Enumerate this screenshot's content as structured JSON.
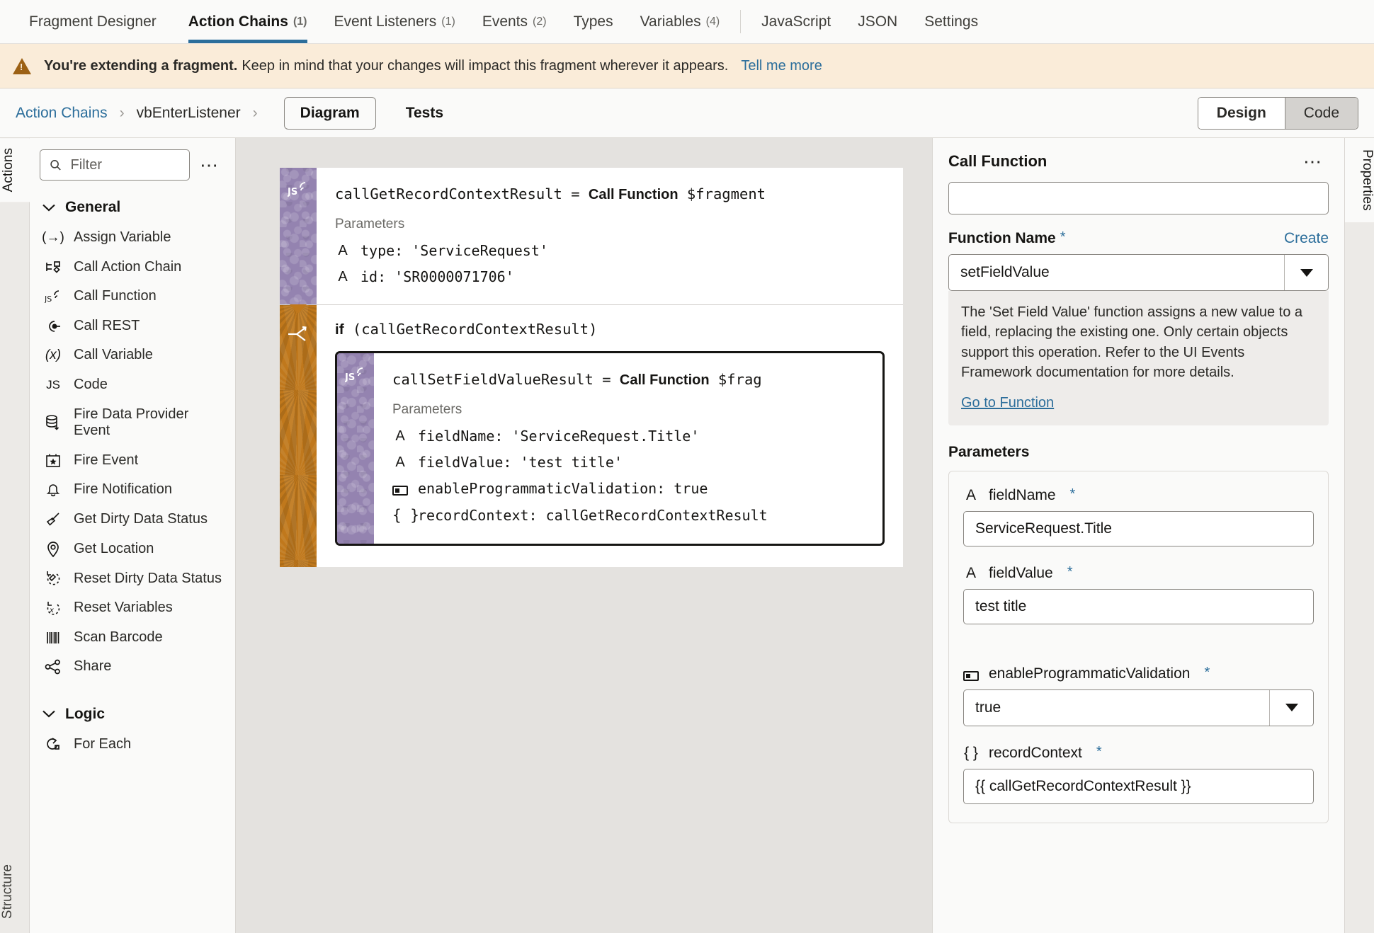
{
  "theme": {
    "accent": "#2c6e9b",
    "warning_bg": "#faecd9",
    "js_node": "#9483b0",
    "if_node": "#c0781c"
  },
  "topbar": {
    "tabs": [
      {
        "label": "Fragment Designer",
        "count": "",
        "active": false
      },
      {
        "label": "Action Chains",
        "count": "(1)",
        "active": true
      },
      {
        "label": "Event Listeners",
        "count": "(1)",
        "active": false
      },
      {
        "label": "Events",
        "count": "(2)",
        "active": false
      },
      {
        "label": "Types",
        "count": "",
        "active": false
      },
      {
        "label": "Variables",
        "count": "(4)",
        "active": false
      }
    ],
    "tabs_right": [
      {
        "label": "JavaScript",
        "count": "",
        "active": false
      },
      {
        "label": "JSON",
        "count": "",
        "active": false
      },
      {
        "label": "Settings",
        "count": "",
        "active": false
      }
    ]
  },
  "banner": {
    "icon": "warning-triangle-icon",
    "bold": "You're extending a fragment.",
    "message": "Keep in mind that your changes will impact this fragment wherever it appears.",
    "link": "Tell me more"
  },
  "breadcrumb": {
    "root": "Action Chains",
    "separator": "›",
    "current": "vbEnterListener",
    "subtabs": [
      {
        "label": "Diagram",
        "active": true
      },
      {
        "label": "Tests",
        "active": false
      }
    ],
    "mode_toggle": [
      {
        "label": "Design",
        "selected": false
      },
      {
        "label": "Code",
        "selected": true
      }
    ]
  },
  "left_rail": {
    "tabs": [
      {
        "label": "Actions",
        "active": true
      },
      {
        "label": "Structure",
        "active": false
      }
    ]
  },
  "actions_panel": {
    "filter": {
      "placeholder": "Filter",
      "value": "",
      "icon": "search-icon"
    },
    "overflow_icon": "ellipsis-icon",
    "groups": [
      {
        "name": "General",
        "expanded": true,
        "items": [
          {
            "label": "Assign Variable",
            "icon": "assign-variable-icon",
            "glyph": "(→)"
          },
          {
            "label": "Call Action Chain",
            "icon": "call-action-chain-icon",
            "glyph": "⎇"
          },
          {
            "label": "Call Function",
            "icon": "call-function-icon",
            "glyph": "JS"
          },
          {
            "label": "Call REST",
            "icon": "call-rest-icon",
            "glyph": "◔"
          },
          {
            "label": "Call Variable",
            "icon": "call-variable-icon",
            "glyph": "(x)"
          },
          {
            "label": "Code",
            "icon": "code-icon",
            "glyph": "JS"
          },
          {
            "label": "Fire Data Provider Event",
            "icon": "fire-data-provider-event-icon",
            "glyph": "⛃"
          },
          {
            "label": "Fire Event",
            "icon": "fire-event-icon",
            "glyph": "★"
          },
          {
            "label": "Fire Notification",
            "icon": "fire-notification-icon",
            "glyph": "⌂"
          },
          {
            "label": "Get Dirty Data Status",
            "icon": "get-dirty-data-status-icon",
            "glyph": "✐"
          },
          {
            "label": "Get Location",
            "icon": "get-location-icon",
            "glyph": "⦿"
          },
          {
            "label": "Reset Dirty Data Status",
            "icon": "reset-dirty-data-status-icon",
            "glyph": "↺"
          },
          {
            "label": "Reset Variables",
            "icon": "reset-variables-icon",
            "glyph": "↺"
          },
          {
            "label": "Scan Barcode",
            "icon": "scan-barcode-icon",
            "glyph": "‖"
          },
          {
            "label": "Share",
            "icon": "share-icon",
            "glyph": "ↂ"
          }
        ]
      },
      {
        "name": "Logic",
        "expanded": true,
        "items": [
          {
            "label": "For Each",
            "icon": "for-each-icon",
            "glyph": "↻"
          }
        ]
      }
    ]
  },
  "diagram": {
    "nodes": [
      {
        "kind": "call-function",
        "icon": "js-call-function-icon",
        "code_prefix": "callGetRecordContextResult = ",
        "code_bold": "Call Function",
        "code_suffix": " $fragment",
        "params_header": "Parameters",
        "params": [
          {
            "type": "string",
            "glyph": "A",
            "text": "type: 'ServiceRequest'"
          },
          {
            "type": "string",
            "glyph": "A",
            "text": "id: 'SR0000071706'"
          }
        ]
      },
      {
        "kind": "if",
        "icon": "branch-icon",
        "condition_keyword": "if",
        "condition_expr": " (callGetRecordContextResult)",
        "child": {
          "kind": "call-function",
          "icon": "js-call-function-icon",
          "code_prefix": "callSetFieldValueResult = ",
          "code_bold": "Call Function",
          "code_suffix": " $frag",
          "params_header": "Parameters",
          "params": [
            {
              "type": "string",
              "glyph": "A",
              "text": "fieldName: 'ServiceRequest.Title'"
            },
            {
              "type": "string",
              "glyph": "A",
              "text": "fieldValue: 'test title'"
            },
            {
              "type": "boolean",
              "glyph": "",
              "text": "enableProgrammaticValidation: true"
            },
            {
              "type": "object",
              "glyph": "{ }",
              "text": "recordContext: callGetRecordContextResult"
            }
          ]
        }
      }
    ]
  },
  "properties": {
    "title": "Call Function",
    "overflow_icon": "ellipsis-icon",
    "rail_label": "Properties",
    "function_name": {
      "label": "Function Name",
      "required": "*",
      "create_link": "Create",
      "value": "setFieldValue",
      "help": "The 'Set Field Value' function assigns a new value to a field, replacing the existing one. Only certain objects support this operation. Refer to the UI Events Framework documentation for more details.",
      "help_link": "Go to Function"
    },
    "parameters_title": "Parameters",
    "parameters": [
      {
        "name": "fieldName",
        "required": "*",
        "glyph": "A",
        "icon": "string-type-icon",
        "control": "text",
        "value": "ServiceRequest.Title"
      },
      {
        "name": "fieldValue",
        "required": "*",
        "glyph": "A",
        "icon": "string-type-icon",
        "control": "text",
        "value": "test title"
      },
      {
        "name": "enableProgrammaticValidation",
        "required": "*",
        "glyph": "",
        "icon": "boolean-type-icon",
        "control": "select",
        "value": "true"
      },
      {
        "name": "recordContext",
        "required": "*",
        "glyph": "{ }",
        "icon": "object-type-icon",
        "control": "text",
        "value": "{{ callGetRecordContextResult }}"
      }
    ]
  }
}
